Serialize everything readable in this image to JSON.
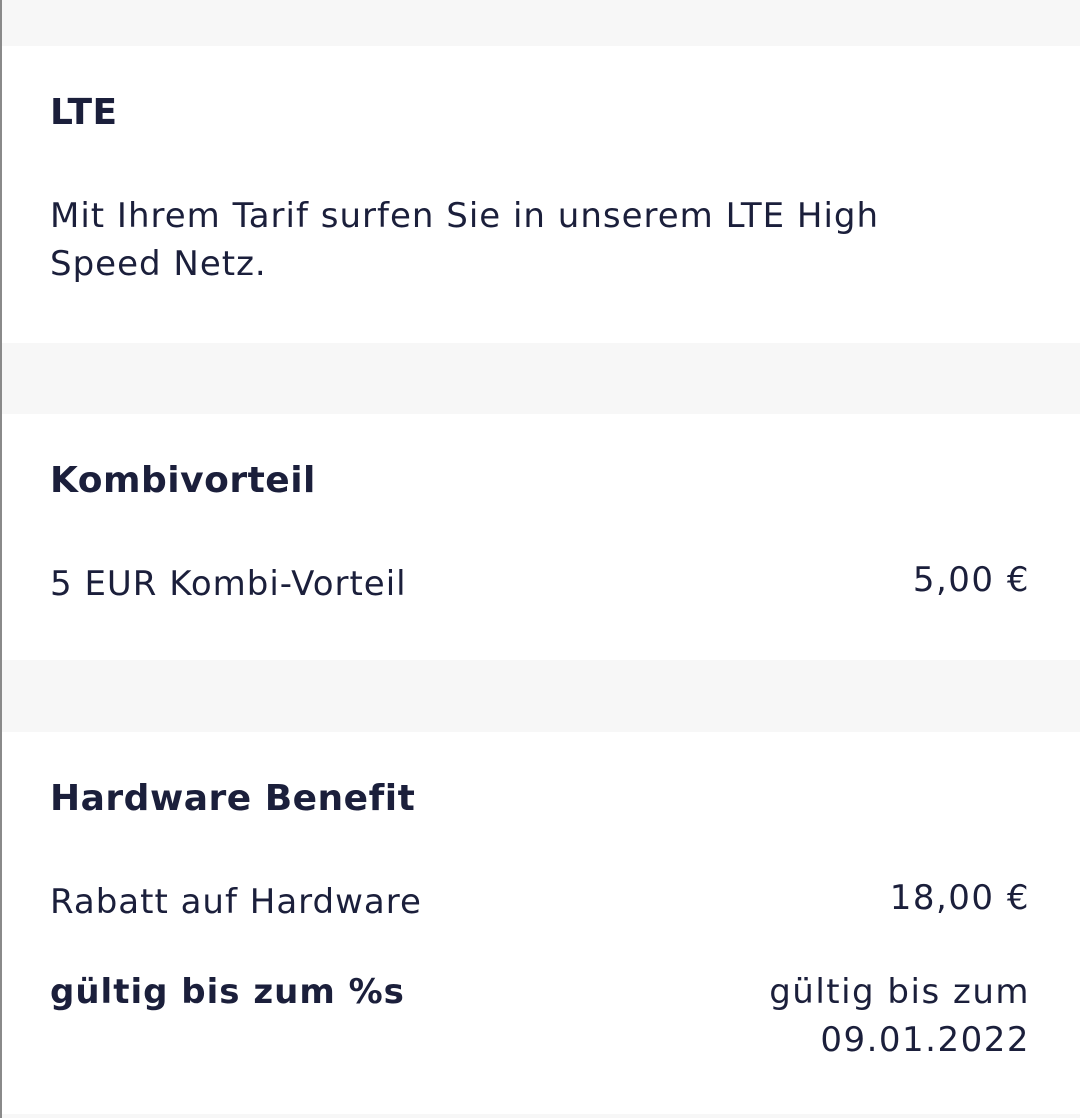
{
  "sections": {
    "lte": {
      "title": "LTE",
      "description": "Mit Ihrem Tarif surfen Sie in unserem LTE High Speed Netz."
    },
    "kombi": {
      "title": "Kombivorteil",
      "item_label": "5 EUR Kombi-Vorteil",
      "item_value": "5,00 €"
    },
    "hardware": {
      "title": "Hardware Benefit",
      "item_label": "Rabatt auf Hardware",
      "item_value": "18,00 €",
      "validity_label": "gültig bis zum %s",
      "validity_value": "gültig bis zum 09.01.2022"
    }
  }
}
